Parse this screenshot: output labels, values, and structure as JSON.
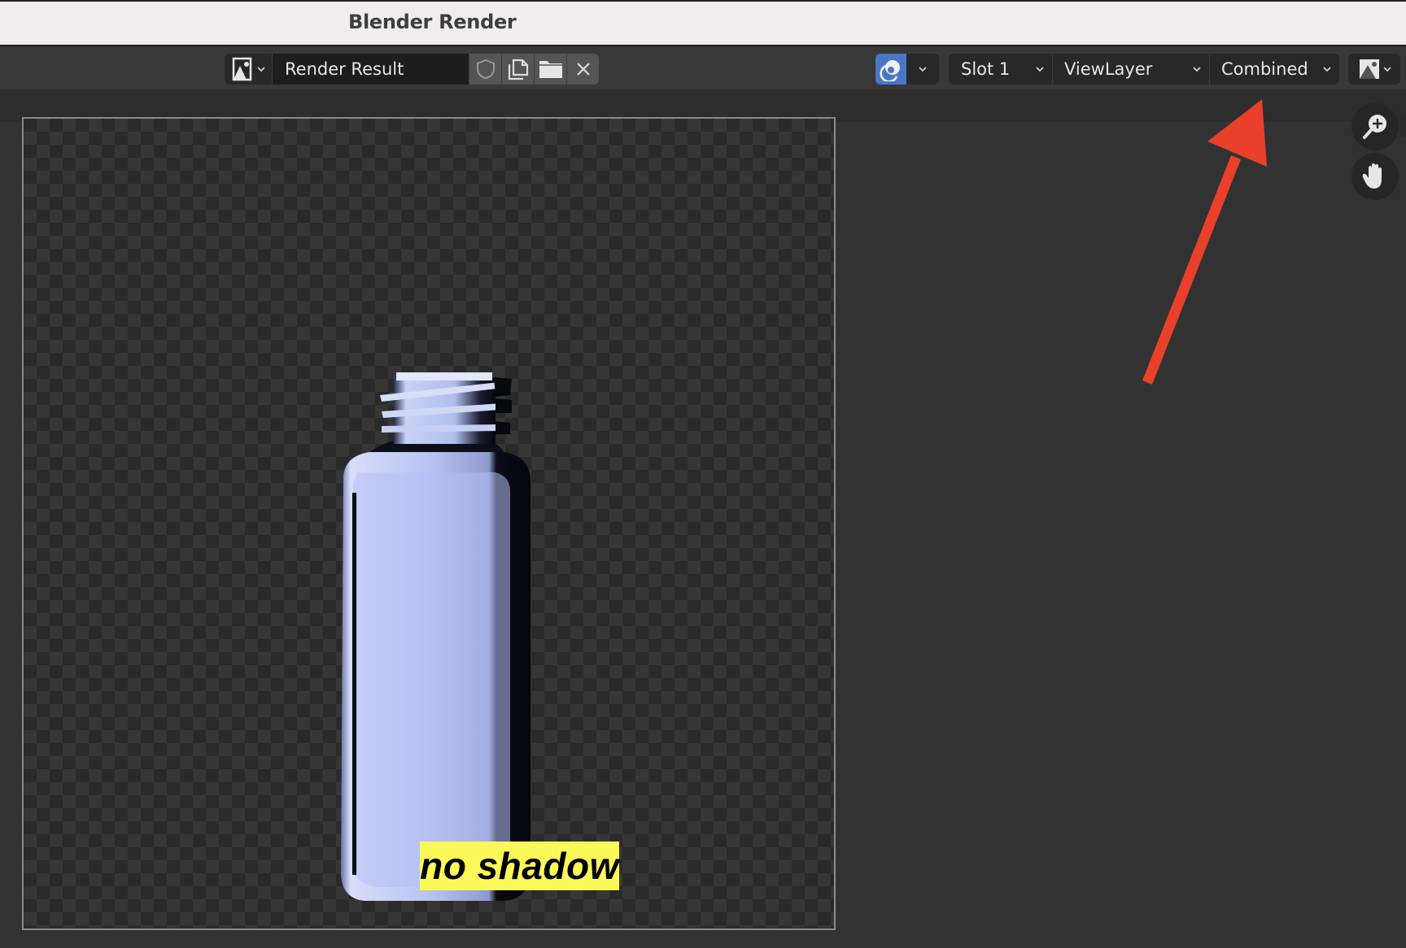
{
  "window": {
    "title": "Blender Render"
  },
  "header": {
    "image_browse_icon": "image-icon",
    "image_name": "Render Result",
    "buttons": [
      {
        "name": "fake-user",
        "icon": "shield-icon"
      },
      {
        "name": "new-image",
        "icon": "duplicate-icon"
      },
      {
        "name": "open-image",
        "icon": "folder-icon"
      },
      {
        "name": "unlink-image",
        "icon": "close-icon"
      }
    ],
    "pin_icon": "render-pin-icon",
    "slot": "Slot 1",
    "view_layer": "ViewLayer",
    "pass": "Combined",
    "display_channels_icon": "display-channels-icon"
  },
  "viewport": {
    "render_label": "no shadow",
    "tools": [
      {
        "name": "zoom",
        "icon": "zoom-in-icon"
      },
      {
        "name": "pan",
        "icon": "hand-icon"
      }
    ]
  },
  "annotation": {
    "type": "arrow",
    "color": "#e8402a",
    "points_to": "Combined"
  },
  "colors": {
    "accent_blue": "#4a76c6",
    "label_yellow": "#fbf95a",
    "bottle_tint": "#b4c0f4"
  }
}
